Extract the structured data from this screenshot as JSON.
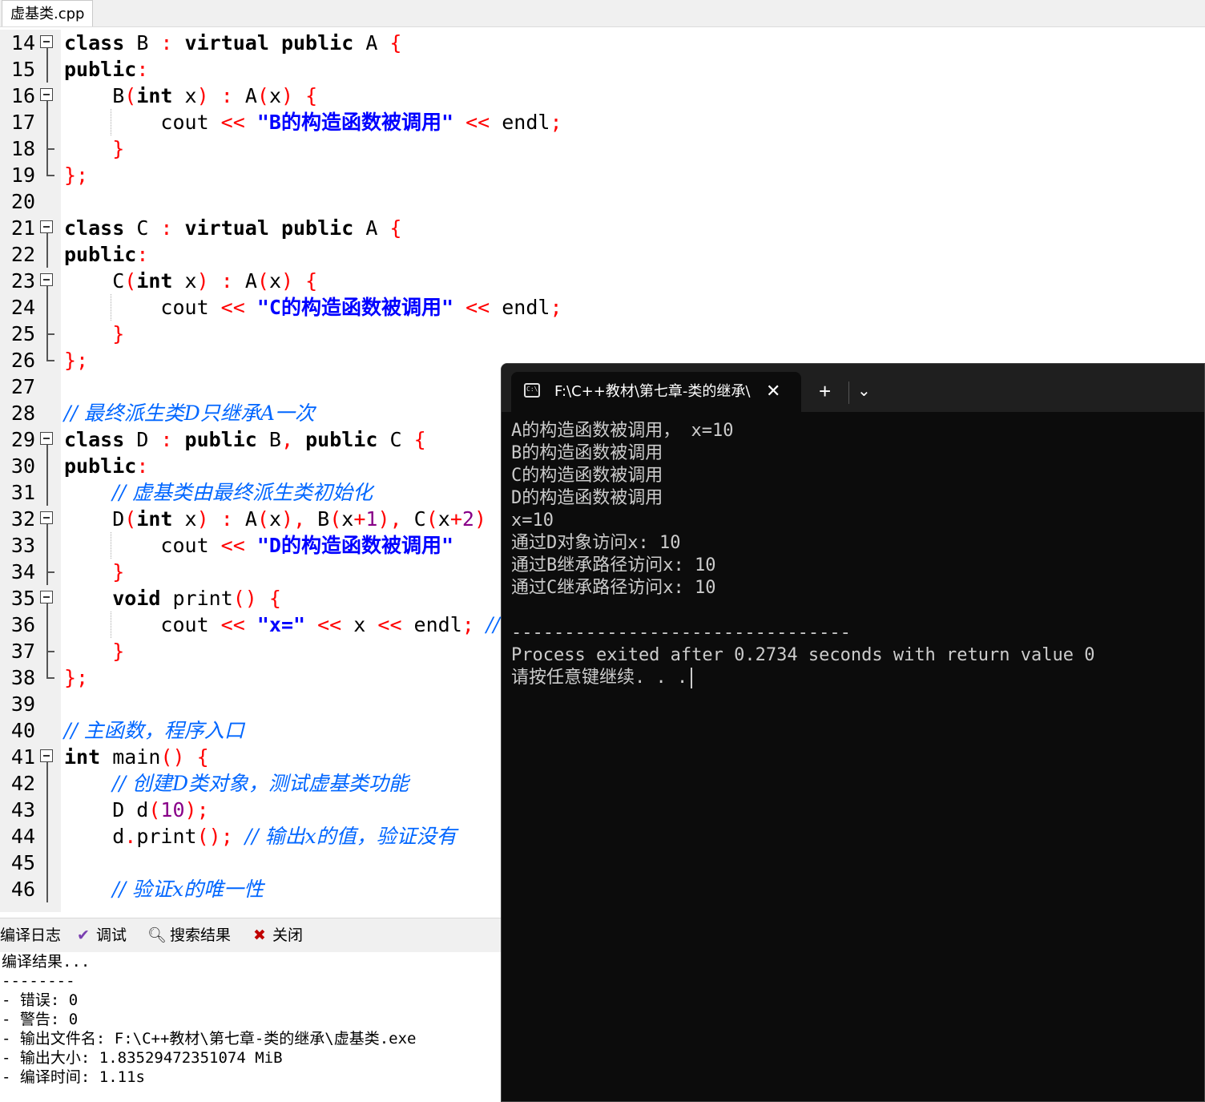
{
  "file_tab": {
    "label": "虚基类.cpp"
  },
  "editor": {
    "lines": [
      {
        "n": "14",
        "fold": "open",
        "tokens": [
          [
            "kw",
            "class"
          ],
          [
            "id",
            " B "
          ],
          [
            "op",
            ":"
          ],
          [
            "id",
            " "
          ],
          [
            "kw",
            "virtual public"
          ],
          [
            "id",
            " A "
          ],
          [
            "op",
            "{"
          ]
        ]
      },
      {
        "n": "15",
        "fold": "line",
        "tokens": [
          [
            "kw",
            "public"
          ],
          [
            "op",
            ":"
          ]
        ]
      },
      {
        "n": "16",
        "fold": "open",
        "tokens": [
          [
            "id",
            "    B"
          ],
          [
            "op",
            "("
          ],
          [
            "kw",
            "int"
          ],
          [
            "id",
            " x"
          ],
          [
            "op",
            ")"
          ],
          [
            "id",
            " "
          ],
          [
            "op",
            ":"
          ],
          [
            "id",
            " A"
          ],
          [
            "op",
            "("
          ],
          [
            "id",
            "x"
          ],
          [
            "op",
            ")"
          ],
          [
            "id",
            " "
          ],
          [
            "op",
            "{"
          ]
        ]
      },
      {
        "n": "17",
        "fold": "line",
        "guide": true,
        "tokens": [
          [
            "id",
            "        cout "
          ],
          [
            "op",
            "<<"
          ],
          [
            "id",
            " "
          ],
          [
            "str",
            "\"B的构造函数被调用\""
          ],
          [
            "id",
            " "
          ],
          [
            "op",
            "<<"
          ],
          [
            "id",
            " endl"
          ],
          [
            "op",
            ";"
          ]
        ]
      },
      {
        "n": "18",
        "fold": "end",
        "tokens": [
          [
            "id",
            "    "
          ],
          [
            "op",
            "}"
          ]
        ]
      },
      {
        "n": "19",
        "fold": "last",
        "tokens": [
          [
            "op",
            "};"
          ]
        ]
      },
      {
        "n": "20",
        "fold": "",
        "tokens": []
      },
      {
        "n": "21",
        "fold": "open",
        "tokens": [
          [
            "kw",
            "class"
          ],
          [
            "id",
            " C "
          ],
          [
            "op",
            ":"
          ],
          [
            "id",
            " "
          ],
          [
            "kw",
            "virtual public"
          ],
          [
            "id",
            " A "
          ],
          [
            "op",
            "{"
          ]
        ]
      },
      {
        "n": "22",
        "fold": "line",
        "tokens": [
          [
            "kw",
            "public"
          ],
          [
            "op",
            ":"
          ]
        ]
      },
      {
        "n": "23",
        "fold": "open",
        "tokens": [
          [
            "id",
            "    C"
          ],
          [
            "op",
            "("
          ],
          [
            "kw",
            "int"
          ],
          [
            "id",
            " x"
          ],
          [
            "op",
            ")"
          ],
          [
            "id",
            " "
          ],
          [
            "op",
            ":"
          ],
          [
            "id",
            " A"
          ],
          [
            "op",
            "("
          ],
          [
            "id",
            "x"
          ],
          [
            "op",
            ")"
          ],
          [
            "id",
            " "
          ],
          [
            "op",
            "{"
          ]
        ]
      },
      {
        "n": "24",
        "fold": "line",
        "guide": true,
        "tokens": [
          [
            "id",
            "        cout "
          ],
          [
            "op",
            "<<"
          ],
          [
            "id",
            " "
          ],
          [
            "str",
            "\"C的构造函数被调用\""
          ],
          [
            "id",
            " "
          ],
          [
            "op",
            "<<"
          ],
          [
            "id",
            " endl"
          ],
          [
            "op",
            ";"
          ]
        ]
      },
      {
        "n": "25",
        "fold": "end",
        "tokens": [
          [
            "id",
            "    "
          ],
          [
            "op",
            "}"
          ]
        ]
      },
      {
        "n": "26",
        "fold": "last",
        "tokens": [
          [
            "op",
            "};"
          ]
        ]
      },
      {
        "n": "27",
        "fold": "",
        "tokens": []
      },
      {
        "n": "28",
        "fold": "",
        "tokens": [
          [
            "cm",
            "// 最终派生类D只继承A一次"
          ]
        ]
      },
      {
        "n": "29",
        "fold": "open",
        "tokens": [
          [
            "kw",
            "class"
          ],
          [
            "id",
            " D "
          ],
          [
            "op",
            ":"
          ],
          [
            "id",
            " "
          ],
          [
            "kw",
            "public"
          ],
          [
            "id",
            " B"
          ],
          [
            "op",
            ","
          ],
          [
            "id",
            " "
          ],
          [
            "kw",
            "public"
          ],
          [
            "id",
            " C "
          ],
          [
            "op",
            "{"
          ]
        ]
      },
      {
        "n": "30",
        "fold": "line",
        "tokens": [
          [
            "kw",
            "public"
          ],
          [
            "op",
            ":"
          ]
        ]
      },
      {
        "n": "31",
        "fold": "line",
        "tokens": [
          [
            "id",
            "    "
          ],
          [
            "cm",
            "// 虚基类由最终派生类初始化"
          ]
        ]
      },
      {
        "n": "32",
        "fold": "open",
        "tokens": [
          [
            "id",
            "    D"
          ],
          [
            "op",
            "("
          ],
          [
            "kw",
            "int"
          ],
          [
            "id",
            " x"
          ],
          [
            "op",
            ")"
          ],
          [
            "id",
            " "
          ],
          [
            "op",
            ":"
          ],
          [
            "id",
            " A"
          ],
          [
            "op",
            "("
          ],
          [
            "id",
            "x"
          ],
          [
            "op",
            "),"
          ],
          [
            "id",
            " B"
          ],
          [
            "op",
            "("
          ],
          [
            "id",
            "x"
          ],
          [
            "op",
            "+"
          ],
          [
            "num",
            "1"
          ],
          [
            "op",
            "),"
          ],
          [
            "id",
            " C"
          ],
          [
            "op",
            "("
          ],
          [
            "id",
            "x"
          ],
          [
            "op",
            "+"
          ],
          [
            "num",
            "2"
          ],
          [
            "op",
            ")"
          ]
        ]
      },
      {
        "n": "33",
        "fold": "line",
        "guide": true,
        "tokens": [
          [
            "id",
            "        cout "
          ],
          [
            "op",
            "<<"
          ],
          [
            "id",
            " "
          ],
          [
            "str",
            "\"D的构造函数被调用\""
          ]
        ]
      },
      {
        "n": "34",
        "fold": "end",
        "tokens": [
          [
            "id",
            "    "
          ],
          [
            "op",
            "}"
          ]
        ]
      },
      {
        "n": "35",
        "fold": "open",
        "tokens": [
          [
            "id",
            "    "
          ],
          [
            "kw",
            "void"
          ],
          [
            "id",
            " print"
          ],
          [
            "op",
            "()"
          ],
          [
            "id",
            " "
          ],
          [
            "op",
            "{"
          ]
        ]
      },
      {
        "n": "36",
        "fold": "line",
        "guide": true,
        "tokens": [
          [
            "id",
            "        cout "
          ],
          [
            "op",
            "<<"
          ],
          [
            "id",
            " "
          ],
          [
            "str",
            "\"x=\""
          ],
          [
            "id",
            " "
          ],
          [
            "op",
            "<<"
          ],
          [
            "id",
            " x "
          ],
          [
            "op",
            "<<"
          ],
          [
            "id",
            " endl"
          ],
          [
            "op",
            ";"
          ],
          [
            "id",
            " "
          ],
          [
            "cm",
            "//"
          ]
        ]
      },
      {
        "n": "37",
        "fold": "end",
        "tokens": [
          [
            "id",
            "    "
          ],
          [
            "op",
            "}"
          ]
        ]
      },
      {
        "n": "38",
        "fold": "last",
        "tokens": [
          [
            "op",
            "};"
          ]
        ]
      },
      {
        "n": "39",
        "fold": "",
        "tokens": []
      },
      {
        "n": "40",
        "fold": "",
        "tokens": [
          [
            "cm",
            "// 主函数，程序入口"
          ]
        ]
      },
      {
        "n": "41",
        "fold": "open",
        "tokens": [
          [
            "kw",
            "int"
          ],
          [
            "id",
            " main"
          ],
          [
            "op",
            "()"
          ],
          [
            "id",
            " "
          ],
          [
            "op",
            "{"
          ]
        ]
      },
      {
        "n": "42",
        "fold": "line",
        "tokens": [
          [
            "id",
            "    "
          ],
          [
            "cm",
            "// 创建D类对象，测试虚基类功能"
          ]
        ]
      },
      {
        "n": "43",
        "fold": "line",
        "tokens": [
          [
            "id",
            "    D d"
          ],
          [
            "op",
            "("
          ],
          [
            "num",
            "10"
          ],
          [
            "op",
            ");"
          ]
        ]
      },
      {
        "n": "44",
        "fold": "line",
        "tokens": [
          [
            "id",
            "    d"
          ],
          [
            "op",
            "."
          ],
          [
            "id",
            "print"
          ],
          [
            "op",
            "();"
          ],
          [
            "id",
            " "
          ],
          [
            "cm",
            "// 输出x的值，验证没有"
          ]
        ]
      },
      {
        "n": "45",
        "fold": "line",
        "tokens": []
      },
      {
        "n": "46",
        "fold": "line",
        "tokens": [
          [
            "id",
            "    "
          ],
          [
            "cm",
            "// 验证x的唯一性"
          ]
        ]
      }
    ]
  },
  "bottom_panel": {
    "tabs": [
      {
        "label": "编译日志",
        "icon": "compile-log-icon"
      },
      {
        "label": "调试",
        "icon": "check-icon"
      },
      {
        "label": "搜索结果",
        "icon": "search-icon"
      },
      {
        "label": "关闭",
        "icon": "close-panel-icon"
      }
    ],
    "log": [
      "编译结果...",
      "--------",
      "- 错误: 0",
      "- 警告: 0",
      "- 输出文件名: F:\\C++教材\\第七章-类的继承\\虚基类.exe",
      "- 输出大小: 1.83529472351074 MiB",
      "- 编译时间: 1.11s"
    ]
  },
  "terminal": {
    "title": "F:\\C++教材\\第七章-类的继承\\",
    "lines": [
      "A的构造函数被调用， x=10",
      "B的构造函数被调用",
      "C的构造函数被调用",
      "D的构造函数被调用",
      "x=10",
      "通过D对象访问x: 10",
      "通过B继承路径访问x: 10",
      "通过C继承路径访问x: 10",
      "",
      "--------------------------------",
      "Process exited after 0.2734 seconds with return value 0",
      "请按任意键继续. . ."
    ]
  }
}
